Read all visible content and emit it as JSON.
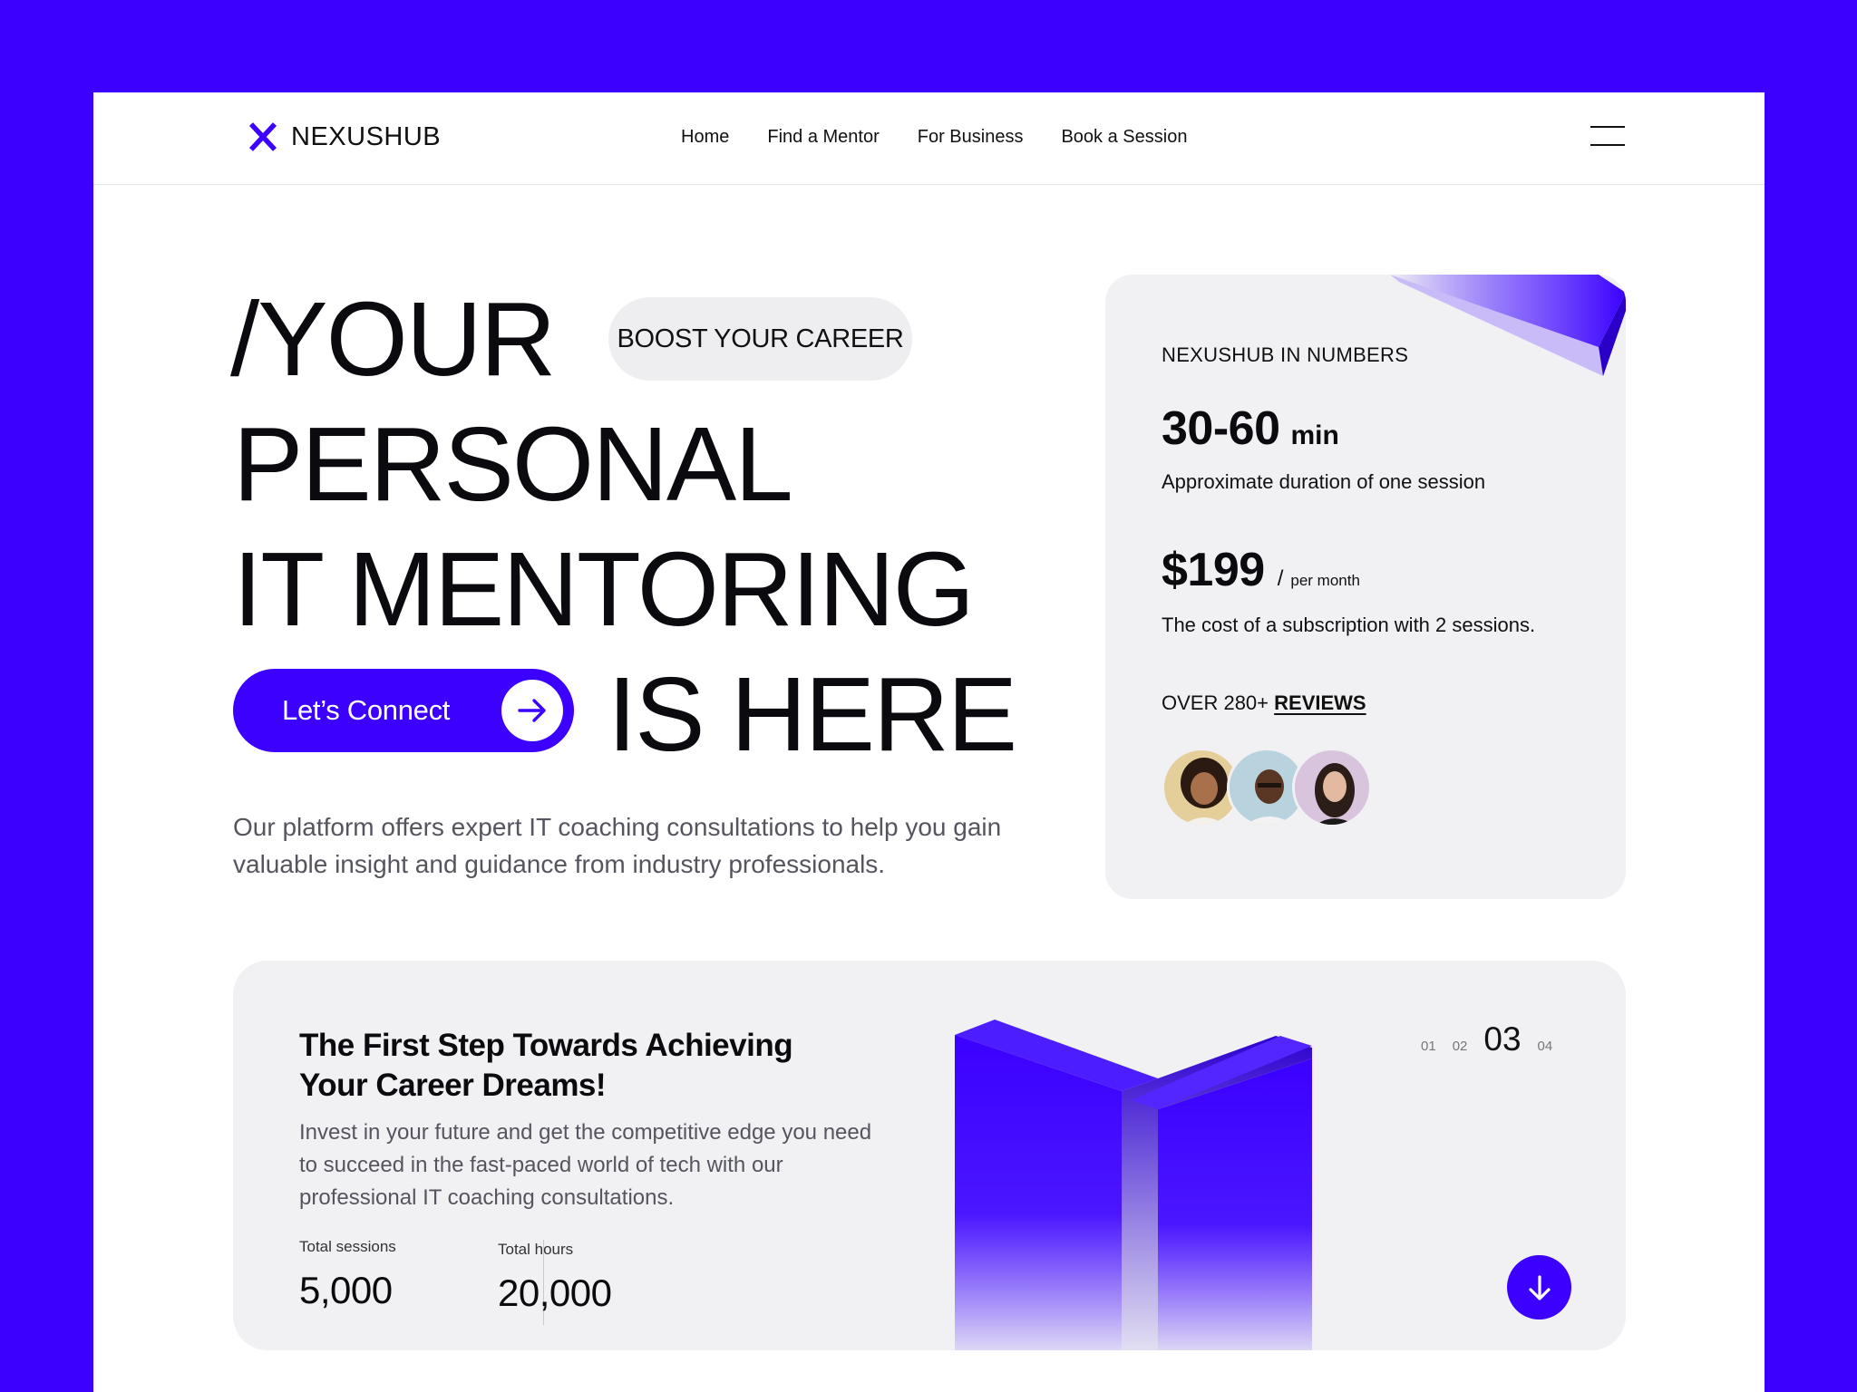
{
  "brand": {
    "name": "NEXUSHUB",
    "accent": "#3B00FF"
  },
  "nav": {
    "items": [
      {
        "label": "Home"
      },
      {
        "label": "Find a Mentor"
      },
      {
        "label": "For Business"
      },
      {
        "label": "Book a Session"
      }
    ],
    "menu_icon": "hamburger-icon"
  },
  "hero": {
    "line1": "/YOUR",
    "line2": "PERSONAL",
    "line3": "IT MENTORING",
    "line4": "IS HERE",
    "badge": "BOOST YOUR CAREER",
    "cta_label": "Let’s Connect",
    "cta_icon": "arrow-right-icon",
    "description": "Our platform offers expert IT coaching consultations to help you gain valuable insight and guidance from industry professionals."
  },
  "numbers": {
    "title": "NEXUSHUB IN NUMBERS",
    "duration_value": "30-60",
    "duration_unit": "min",
    "duration_desc": "Approximate duration of one session",
    "price_value": "$199",
    "price_sep": "/",
    "price_unit": "per month",
    "price_desc": "The cost of a subscription with 2 sessions.",
    "reviews_prefix": "OVER 280+",
    "reviews_link": "REVIEWS"
  },
  "promo": {
    "title": "The First Step Towards Achieving Your Career Dreams!",
    "description": "Invest in your future and get the competitive edge you need to succeed in the fast-paced world of tech with our professional IT coaching consultations.",
    "stats": [
      {
        "label": "Total sessions",
        "value": "5,000"
      },
      {
        "label": "Total hours",
        "value": "20,000"
      }
    ],
    "pager": [
      "01",
      "02",
      "03",
      "04"
    ],
    "pager_active": "03",
    "scroll_icon": "arrow-down-icon"
  }
}
